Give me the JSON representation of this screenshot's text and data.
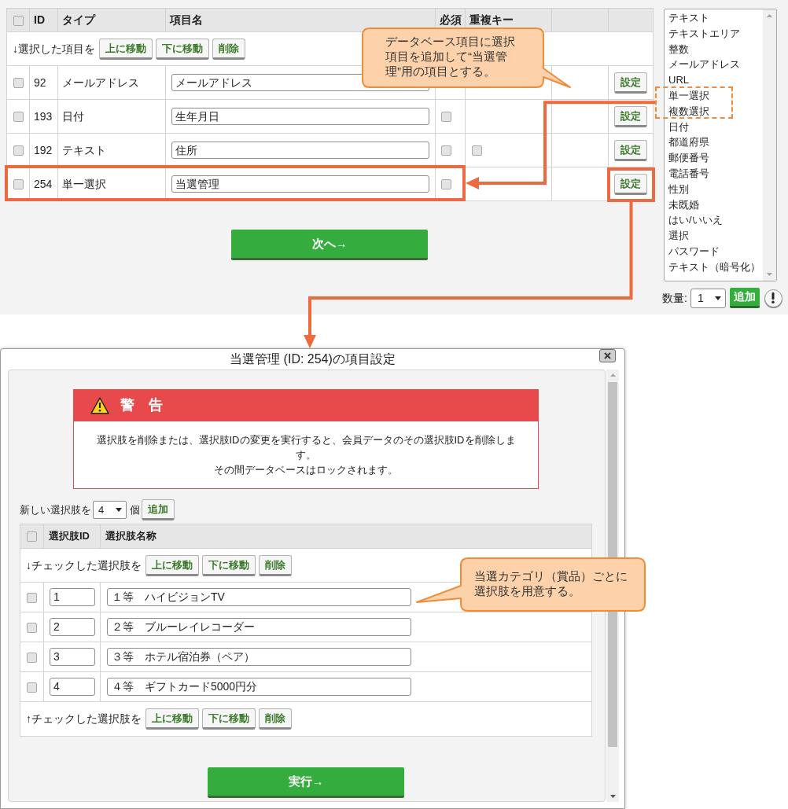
{
  "field_table": {
    "select_all_checked": false,
    "columns": [
      "ID",
      "タイプ",
      "項目名",
      "必須",
      "重複キー"
    ],
    "action_bar": {
      "label": "↓選択した項目を",
      "buttons": [
        "上に移動",
        "下に移動",
        "削除"
      ]
    },
    "rows": [
      {
        "checked": false,
        "id": "92",
        "type": "メールアドレス",
        "name": "メールアドレス",
        "button": "設定",
        "highlighted": false,
        "button_highlighted": false
      },
      {
        "checked": false,
        "id": "193",
        "type": "日付",
        "name": "生年月日",
        "required_checked": false,
        "button": "設定",
        "highlighted": false,
        "button_highlighted": false
      },
      {
        "checked": false,
        "id": "192",
        "type": "テキスト",
        "name": "住所",
        "required_checked": false,
        "duplicate_key_checked": false,
        "button": "設定",
        "highlighted": false,
        "button_highlighted": false
      },
      {
        "checked": false,
        "id": "254",
        "type": "単一選択",
        "name": "当選管理",
        "required_checked": false,
        "button": "設定",
        "highlighted": true,
        "button_highlighted": true
      }
    ]
  },
  "callout": "データベース項目に選択項目を追加して“当選管理”用の項目とする。",
  "next_button": "次へ→",
  "type_list": {
    "items": [
      {
        "label": "テキスト",
        "selected": false,
        "highlighted": false
      },
      {
        "label": "テキストエリア",
        "selected": false,
        "highlighted": false
      },
      {
        "label": "整数",
        "selected": false,
        "highlighted": false
      },
      {
        "label": "メールアドレス",
        "selected": false,
        "highlighted": false
      },
      {
        "label": "URL",
        "selected": false,
        "highlighted": false
      },
      {
        "label": "単一選択",
        "selected": false,
        "highlighted": true
      },
      {
        "label": "複数選択",
        "selected": false,
        "highlighted": true
      },
      {
        "label": "日付",
        "selected": false,
        "highlighted": false
      },
      {
        "label": "都道府県",
        "selected": false,
        "highlighted": false
      },
      {
        "label": "郵便番号",
        "selected": false,
        "highlighted": false
      },
      {
        "label": "電話番号",
        "selected": false,
        "highlighted": false
      },
      {
        "label": "性別",
        "selected": false,
        "highlighted": false
      },
      {
        "label": "未既婚",
        "selected": false,
        "highlighted": false
      },
      {
        "label": "はい/いいえ",
        "selected": false,
        "highlighted": false
      },
      {
        "label": "選択",
        "selected": false,
        "highlighted": false
      },
      {
        "label": "パスワード",
        "selected": false,
        "highlighted": false
      },
      {
        "label": "テキスト（暗号化）",
        "selected": false,
        "highlighted": false
      }
    ]
  },
  "quantity": {
    "label": "数量:",
    "value": "1",
    "add_button": "追加"
  },
  "dialog": {
    "title": "当選管理 (ID: 254)の項目設定",
    "warning": {
      "title": "警　告",
      "paragraphs": [
        "選択肢を削除または、選択肢IDの変更を実行すると、会員データのその選択肢IDを削除します。",
        "その間データベースはロックされます。"
      ]
    },
    "new_choices": {
      "label": "新しい選択肢を",
      "value": "4",
      "unit": "個",
      "button": "追加"
    },
    "choice_table": {
      "select_all_checked": false,
      "columns": [
        "選択肢ID",
        "選択肢名称"
      ],
      "top_bar": {
        "label": "↓チェックした選択肢を",
        "buttons": [
          "上に移動",
          "下に移動",
          "削除"
        ]
      },
      "rows": [
        {
          "checked": false,
          "id": "1",
          "name": "１等　ハイビジョンTV"
        },
        {
          "checked": false,
          "id": "2",
          "name": "２等　ブルーレイレコーダー"
        },
        {
          "checked": false,
          "id": "3",
          "name": "３等　ホテル宿泊券（ペア）"
        },
        {
          "checked": false,
          "id": "4",
          "name": "４等　ギフトカード5000円分"
        }
      ],
      "bottom_bar": {
        "label": "↑チェックした選択肢を",
        "buttons": [
          "上に移動",
          "下に移動",
          "削除"
        ]
      }
    },
    "callout": "当選カテゴリ（賞品）ごとに選択肢を用意する。",
    "submit_button": "実行→"
  }
}
